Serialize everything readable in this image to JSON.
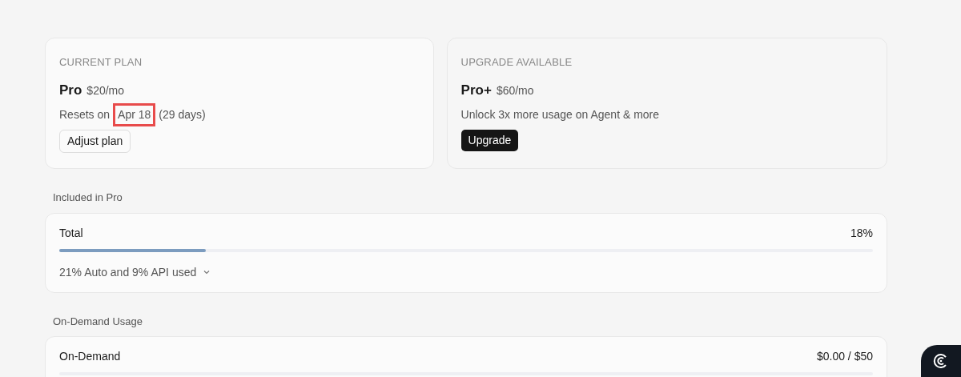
{
  "plans": [
    {
      "kind": "current",
      "heading": "CURRENT PLAN",
      "name": "Pro",
      "price": "$20/mo",
      "reset_prefix": "Resets on",
      "reset_date": "Apr 18",
      "reset_date_highlighted": true,
      "reset_suffix": "(29 days)",
      "button": "Adjust plan"
    },
    {
      "kind": "upgrade",
      "heading": "UPGRADE AVAILABLE",
      "name": "Pro+",
      "price": "$60/mo",
      "description": "Unlock 3x more usage on Agent & more",
      "button": "Upgrade"
    }
  ],
  "sections": [
    {
      "title": "Included in Pro",
      "meter": {
        "label": "Total",
        "reading": "18%",
        "level": 0.18
      },
      "details": {
        "label": "21% Auto and 9% API used",
        "expanded": false
      }
    },
    {
      "title": "On-Demand Usage",
      "meter": {
        "label": "On-Demand",
        "reading": "$0.00 / $50",
        "level": 0
      }
    }
  ]
}
